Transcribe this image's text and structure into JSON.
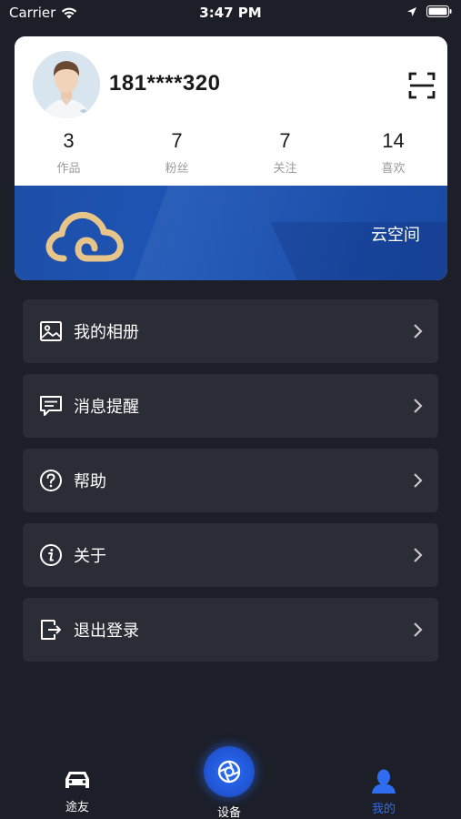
{
  "status_bar": {
    "carrier": "Carrier",
    "time": "3:47 PM"
  },
  "profile": {
    "username": "181****320",
    "stats": [
      {
        "value": "3",
        "label": "作品"
      },
      {
        "value": "7",
        "label": "粉丝"
      },
      {
        "value": "7",
        "label": "关注"
      },
      {
        "value": "14",
        "label": "喜欢"
      }
    ],
    "cloud_label": "云空间"
  },
  "menu": [
    {
      "label": "我的相册",
      "icon": "album-icon"
    },
    {
      "label": "消息提醒",
      "icon": "message-icon"
    },
    {
      "label": "帮助",
      "icon": "help-icon"
    },
    {
      "label": "关于",
      "icon": "info-icon"
    },
    {
      "label": "退出登录",
      "icon": "logout-icon"
    }
  ],
  "tab_bar": {
    "left_label": "途友",
    "center_label": "设备",
    "right_label": "我的",
    "active_color": "#2f6df0",
    "inactive_color": "#ffffff"
  },
  "colors": {
    "background": "#1c1f28",
    "menu_item": "#2a2d36",
    "banner_blue": "#1d55b6",
    "cloud_gold": "#e7c48a"
  }
}
